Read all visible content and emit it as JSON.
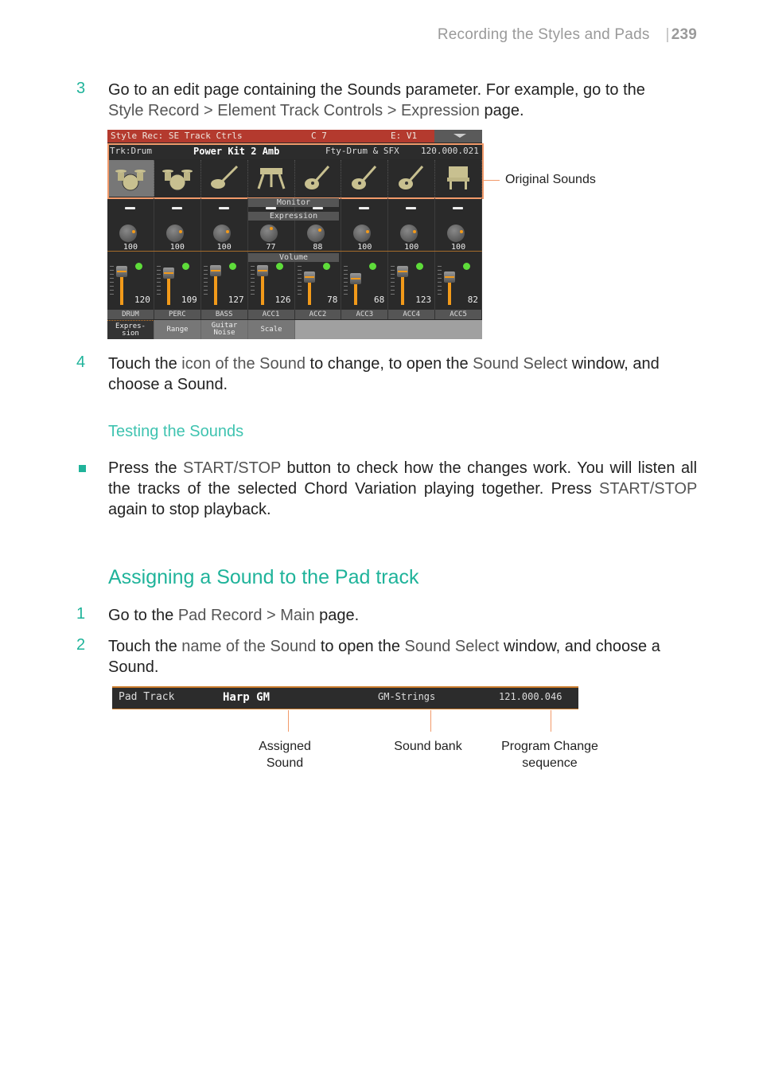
{
  "header": {
    "section": "Recording the Styles and Pads",
    "page_number": "239"
  },
  "step3": {
    "number": "3",
    "text_a": "Go to an edit page containing the Sounds parameter. For example, go to the",
    "path": [
      "Style Record",
      "Element Track Controls",
      "Expression"
    ],
    "separator": " > ",
    "text_b": " page."
  },
  "screen1": {
    "title": "Style Rec: SE Track Ctrls",
    "chord": "C 7",
    "element": "E: V1",
    "track_label": "Trk:Drum",
    "sound_name": "Power Kit 2 Amb",
    "bank": "Fty-Drum & SFX",
    "pc": "120.000.021",
    "section_labels": {
      "monitor": "Monitor",
      "expression": "Expression",
      "volume": "Volume"
    },
    "tracks": [
      {
        "name": "DRUM",
        "icon": "drum-kit-icon",
        "expression": 100,
        "volume": 120
      },
      {
        "name": "PERC",
        "icon": "drum-kit-icon",
        "expression": 100,
        "volume": 109
      },
      {
        "name": "BASS",
        "icon": "electric-bass-icon",
        "expression": 100,
        "volume": 127
      },
      {
        "name": "ACC1",
        "icon": "keyboard-stand-icon",
        "expression": 77,
        "volume": 126
      },
      {
        "name": "ACC2",
        "icon": "acoustic-guitar-icon",
        "expression": 88,
        "volume": 78
      },
      {
        "name": "ACC3",
        "icon": "acoustic-guitar-icon",
        "expression": 100,
        "volume": 68
      },
      {
        "name": "ACC4",
        "icon": "acoustic-guitar-icon",
        "expression": 100,
        "volume": 123
      },
      {
        "name": "ACC5",
        "icon": "piano-icon",
        "expression": 100,
        "volume": 82
      }
    ],
    "tabs": [
      "Expres-\nsion",
      "Range",
      "Guitar\nNoise",
      "Scale"
    ],
    "selected_tab": 0,
    "callout": "Original Sounds"
  },
  "step4": {
    "number": "4",
    "t1": "Touch the ",
    "h1": "icon of the Sound",
    "t2": " to change, to open the ",
    "h2": "Sound Select",
    "t3": " window, and choose a Sound."
  },
  "testing": {
    "title": "Testing the Sounds",
    "bullet": {
      "t1": "Press the ",
      "h1": "START/STOP",
      "t2": " button to check how the changes work. You will lis­ten all the tracks of the selected Chord Variation playing together. Press ",
      "h2": "START/STOP",
      "t3": " again to stop playback."
    }
  },
  "assigning": {
    "title": "Assigning a Sound to the Pad track",
    "step1": {
      "number": "1",
      "t1": "Go to the ",
      "h1": "Pad Record > Main",
      "t2": " page."
    },
    "step2": {
      "number": "2",
      "t1": "Touch the ",
      "h1": "name of the Sound",
      "t2": " to open the ",
      "h2": "Sound Select",
      "t3": " window, and choose a Sound."
    }
  },
  "screen2": {
    "track": "Pad Track",
    "sound": "Harp GM",
    "bank": "GM-Strings",
    "pc": "121.000.046",
    "callouts": [
      "Assigned\nSound",
      "Sound bank",
      "Program Change\nsequence"
    ]
  },
  "colors": {
    "accent": "#1fb39a",
    "callout": "#f29a6a",
    "titlebar": "#b43a2e"
  }
}
